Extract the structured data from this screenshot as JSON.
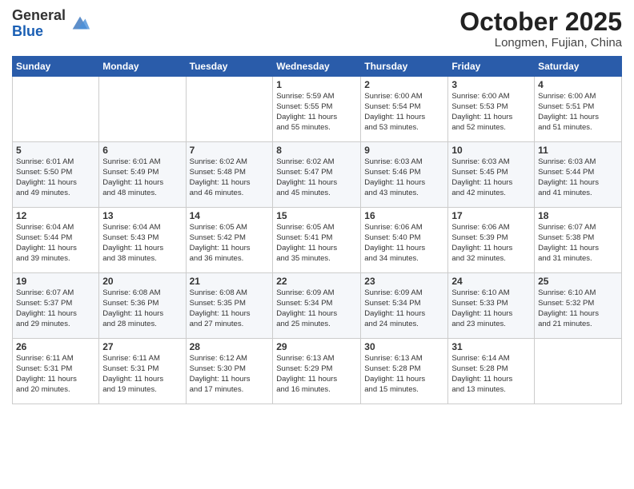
{
  "header": {
    "logo_general": "General",
    "logo_blue": "Blue",
    "month_title": "October 2025",
    "location": "Longmen, Fujian, China"
  },
  "weekdays": [
    "Sunday",
    "Monday",
    "Tuesday",
    "Wednesday",
    "Thursday",
    "Friday",
    "Saturday"
  ],
  "weeks": [
    [
      {
        "day": "",
        "info": ""
      },
      {
        "day": "",
        "info": ""
      },
      {
        "day": "",
        "info": ""
      },
      {
        "day": "1",
        "info": "Sunrise: 5:59 AM\nSunset: 5:55 PM\nDaylight: 11 hours\nand 55 minutes."
      },
      {
        "day": "2",
        "info": "Sunrise: 6:00 AM\nSunset: 5:54 PM\nDaylight: 11 hours\nand 53 minutes."
      },
      {
        "day": "3",
        "info": "Sunrise: 6:00 AM\nSunset: 5:53 PM\nDaylight: 11 hours\nand 52 minutes."
      },
      {
        "day": "4",
        "info": "Sunrise: 6:00 AM\nSunset: 5:51 PM\nDaylight: 11 hours\nand 51 minutes."
      }
    ],
    [
      {
        "day": "5",
        "info": "Sunrise: 6:01 AM\nSunset: 5:50 PM\nDaylight: 11 hours\nand 49 minutes."
      },
      {
        "day": "6",
        "info": "Sunrise: 6:01 AM\nSunset: 5:49 PM\nDaylight: 11 hours\nand 48 minutes."
      },
      {
        "day": "7",
        "info": "Sunrise: 6:02 AM\nSunset: 5:48 PM\nDaylight: 11 hours\nand 46 minutes."
      },
      {
        "day": "8",
        "info": "Sunrise: 6:02 AM\nSunset: 5:47 PM\nDaylight: 11 hours\nand 45 minutes."
      },
      {
        "day": "9",
        "info": "Sunrise: 6:03 AM\nSunset: 5:46 PM\nDaylight: 11 hours\nand 43 minutes."
      },
      {
        "day": "10",
        "info": "Sunrise: 6:03 AM\nSunset: 5:45 PM\nDaylight: 11 hours\nand 42 minutes."
      },
      {
        "day": "11",
        "info": "Sunrise: 6:03 AM\nSunset: 5:44 PM\nDaylight: 11 hours\nand 41 minutes."
      }
    ],
    [
      {
        "day": "12",
        "info": "Sunrise: 6:04 AM\nSunset: 5:44 PM\nDaylight: 11 hours\nand 39 minutes."
      },
      {
        "day": "13",
        "info": "Sunrise: 6:04 AM\nSunset: 5:43 PM\nDaylight: 11 hours\nand 38 minutes."
      },
      {
        "day": "14",
        "info": "Sunrise: 6:05 AM\nSunset: 5:42 PM\nDaylight: 11 hours\nand 36 minutes."
      },
      {
        "day": "15",
        "info": "Sunrise: 6:05 AM\nSunset: 5:41 PM\nDaylight: 11 hours\nand 35 minutes."
      },
      {
        "day": "16",
        "info": "Sunrise: 6:06 AM\nSunset: 5:40 PM\nDaylight: 11 hours\nand 34 minutes."
      },
      {
        "day": "17",
        "info": "Sunrise: 6:06 AM\nSunset: 5:39 PM\nDaylight: 11 hours\nand 32 minutes."
      },
      {
        "day": "18",
        "info": "Sunrise: 6:07 AM\nSunset: 5:38 PM\nDaylight: 11 hours\nand 31 minutes."
      }
    ],
    [
      {
        "day": "19",
        "info": "Sunrise: 6:07 AM\nSunset: 5:37 PM\nDaylight: 11 hours\nand 29 minutes."
      },
      {
        "day": "20",
        "info": "Sunrise: 6:08 AM\nSunset: 5:36 PM\nDaylight: 11 hours\nand 28 minutes."
      },
      {
        "day": "21",
        "info": "Sunrise: 6:08 AM\nSunset: 5:35 PM\nDaylight: 11 hours\nand 27 minutes."
      },
      {
        "day": "22",
        "info": "Sunrise: 6:09 AM\nSunset: 5:34 PM\nDaylight: 11 hours\nand 25 minutes."
      },
      {
        "day": "23",
        "info": "Sunrise: 6:09 AM\nSunset: 5:34 PM\nDaylight: 11 hours\nand 24 minutes."
      },
      {
        "day": "24",
        "info": "Sunrise: 6:10 AM\nSunset: 5:33 PM\nDaylight: 11 hours\nand 23 minutes."
      },
      {
        "day": "25",
        "info": "Sunrise: 6:10 AM\nSunset: 5:32 PM\nDaylight: 11 hours\nand 21 minutes."
      }
    ],
    [
      {
        "day": "26",
        "info": "Sunrise: 6:11 AM\nSunset: 5:31 PM\nDaylight: 11 hours\nand 20 minutes."
      },
      {
        "day": "27",
        "info": "Sunrise: 6:11 AM\nSunset: 5:31 PM\nDaylight: 11 hours\nand 19 minutes."
      },
      {
        "day": "28",
        "info": "Sunrise: 6:12 AM\nSunset: 5:30 PM\nDaylight: 11 hours\nand 17 minutes."
      },
      {
        "day": "29",
        "info": "Sunrise: 6:13 AM\nSunset: 5:29 PM\nDaylight: 11 hours\nand 16 minutes."
      },
      {
        "day": "30",
        "info": "Sunrise: 6:13 AM\nSunset: 5:28 PM\nDaylight: 11 hours\nand 15 minutes."
      },
      {
        "day": "31",
        "info": "Sunrise: 6:14 AM\nSunset: 5:28 PM\nDaylight: 11 hours\nand 13 minutes."
      },
      {
        "day": "",
        "info": ""
      }
    ]
  ]
}
